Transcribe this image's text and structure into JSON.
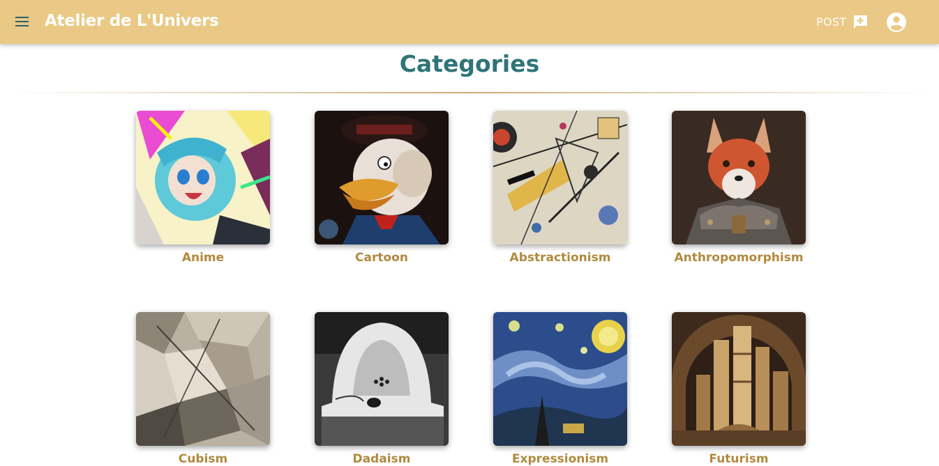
{
  "app": {
    "title": "Atelier de L'Univers",
    "post_label": "POST"
  },
  "icons": {
    "menu": "menu-icon",
    "post": "add-comment-icon",
    "account": "account-circle-icon"
  },
  "colors": {
    "header_bg": "#e9c985",
    "title": "#2f7578",
    "category_label": "#b08a3e"
  },
  "page": {
    "title": "Categories"
  },
  "categories": [
    {
      "label": "Anime"
    },
    {
      "label": "Cartoon"
    },
    {
      "label": "Abstractionism"
    },
    {
      "label": "Anthropomorphism"
    },
    {
      "label": "Cubism"
    },
    {
      "label": "Dadaism"
    },
    {
      "label": "Expressionism"
    },
    {
      "label": "Futurism"
    }
  ]
}
